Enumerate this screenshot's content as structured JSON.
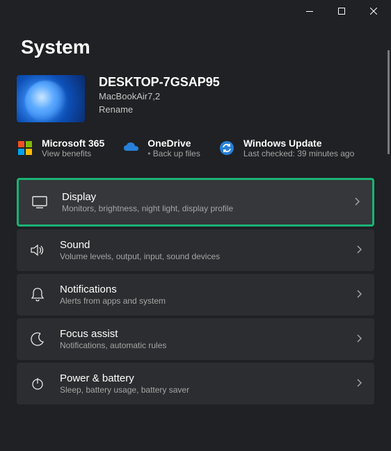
{
  "page": {
    "title": "System"
  },
  "device": {
    "name": "DESKTOP-7GSAP95",
    "model": "MacBookAir7,2",
    "rename_label": "Rename"
  },
  "quick_links": {
    "ms365": {
      "title": "Microsoft 365",
      "sub": "View benefits"
    },
    "onedrive": {
      "title": "OneDrive",
      "sub": "Back up files"
    },
    "update": {
      "title": "Windows Update",
      "sub": "Last checked: 39 minutes ago"
    }
  },
  "settings": [
    {
      "title": "Display",
      "desc": "Monitors, brightness, night light, display profile",
      "highlighted": true
    },
    {
      "title": "Sound",
      "desc": "Volume levels, output, input, sound devices",
      "highlighted": false
    },
    {
      "title": "Notifications",
      "desc": "Alerts from apps and system",
      "highlighted": false
    },
    {
      "title": "Focus assist",
      "desc": "Notifications, automatic rules",
      "highlighted": false
    },
    {
      "title": "Power & battery",
      "desc": "Sleep, battery usage, battery saver",
      "highlighted": false
    }
  ]
}
